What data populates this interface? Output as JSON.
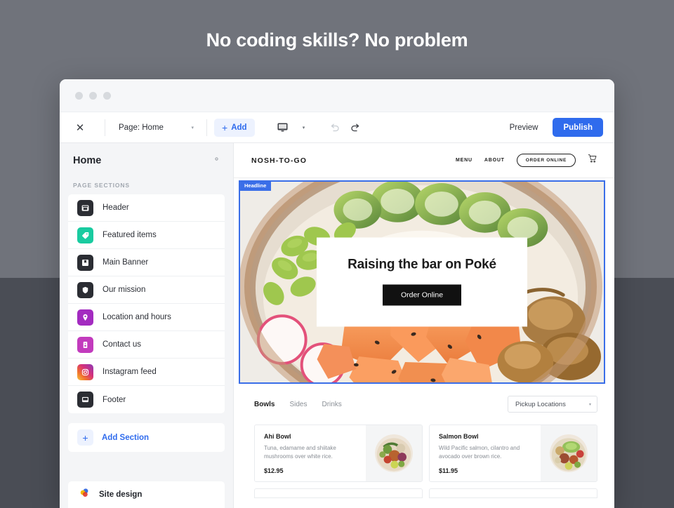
{
  "page": {
    "headline": "No coding skills? No problem",
    "background_top": "#70737b",
    "background_bottom": "#4a4d55"
  },
  "toolbar": {
    "close_label": "✕",
    "page_selector": {
      "value": "Page: Home",
      "caret": "▾"
    },
    "add_button": {
      "plus": "+",
      "label": "Add"
    },
    "device_caret": "▾",
    "preview_label": "Preview",
    "publish_label": "Publish",
    "accent_color": "#2f6bed"
  },
  "sidebar": {
    "title": "Home",
    "section_label": "PAGE SECTIONS",
    "items": [
      {
        "label": "Header",
        "icon": "window-icon",
        "color": "#2b2d33"
      },
      {
        "label": "Featured items",
        "icon": "tag-icon",
        "color": "#19cba0"
      },
      {
        "label": "Main Banner",
        "icon": "bookmark-icon",
        "color": "#2b2d33"
      },
      {
        "label": "Our mission",
        "icon": "shield-icon",
        "color": "#2b2d33"
      },
      {
        "label": "Location and hours",
        "icon": "map-pin-icon",
        "color": "#a32bc0"
      },
      {
        "label": "Contact us",
        "icon": "contact-card-icon",
        "color": "#c23bbd"
      },
      {
        "label": "Instagram feed",
        "icon": "instagram-icon",
        "color": "#d6317a"
      },
      {
        "label": "Footer",
        "icon": "footer-icon",
        "color": "#2b2d33"
      }
    ],
    "add_section": {
      "plus": "+",
      "label": "Add Section"
    },
    "site_design": {
      "label": "Site design"
    }
  },
  "site": {
    "brand": "NOSH-TO-GO",
    "nav": [
      "MENU",
      "ABOUT"
    ],
    "order_pill": "ORDER ONLINE",
    "hero": {
      "badge": "Headline",
      "title": "Raising the bar on Poké",
      "button": "Order Online"
    },
    "menu": {
      "tabs": [
        {
          "label": "Bowls",
          "active": true
        },
        {
          "label": "Sides",
          "active": false
        },
        {
          "label": "Drinks",
          "active": false
        }
      ],
      "pickup_selector": {
        "value": "Pickup Locations",
        "caret": "▾"
      },
      "items": [
        {
          "name": "Ahi Bowl",
          "description": "Tuna, edamame and shiitake mushrooms over white rice.",
          "price": "$12.95"
        },
        {
          "name": "Salmon Bowl",
          "description": "Wild Pacific salmon, cilantro and avocado over brown rice.",
          "price": "$11.95"
        }
      ]
    }
  }
}
